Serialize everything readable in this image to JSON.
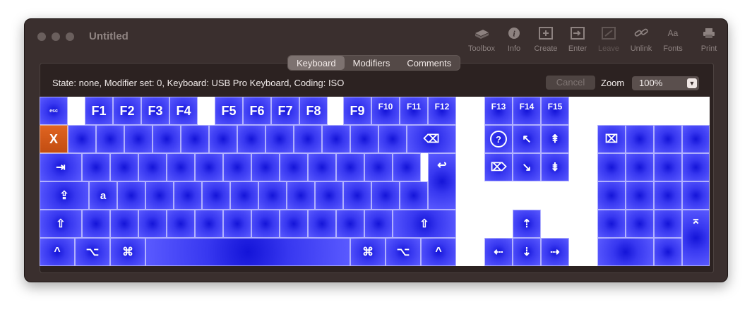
{
  "window": {
    "title": "Untitled"
  },
  "toolbar": {
    "toolbox": "Toolbox",
    "info": "Info",
    "create": "Create",
    "enter": "Enter",
    "leave": "Leave",
    "unlink": "Unlink",
    "fonts": "Fonts",
    "print": "Print",
    "fonts_glyph": "Aa"
  },
  "tabs": [
    "Keyboard",
    "Modifiers",
    "Comments"
  ],
  "status": {
    "text": "State: none, Modifier set: 0, Keyboard: USB Pro Keyboard, Coding: ISO"
  },
  "cancel_label": "Cancel",
  "zoom": {
    "label": "Zoom",
    "value": "100%"
  },
  "colors": {
    "key_blue": "#3030f0",
    "key_highlight": "#d9581a",
    "window_bg": "#3a2f2e"
  },
  "keyboard": {
    "esc": "esc",
    "f_keys": [
      "F1",
      "F2",
      "F3",
      "F4",
      "F5",
      "F6",
      "F7",
      "F8",
      "F9",
      "F10",
      "F11",
      "F12",
      "F13",
      "F14",
      "F15"
    ],
    "x_key": "X",
    "a_key": "a",
    "delete": "⌫",
    "tab": "⇥",
    "return": "↩",
    "caps": "⇪",
    "shift": "⇧",
    "control": "^",
    "option": "⌥",
    "command": "⌘",
    "help": "?",
    "home": "↖",
    "page_up": "⇞",
    "fwd_delete": "⌦",
    "end": "↘",
    "page_down": "⇟",
    "clear": "⌧",
    "arrow_up": "⇡",
    "arrow_left": "⇠",
    "arrow_down": "⇣",
    "arrow_right": "⇢",
    "enter": "⌅"
  }
}
